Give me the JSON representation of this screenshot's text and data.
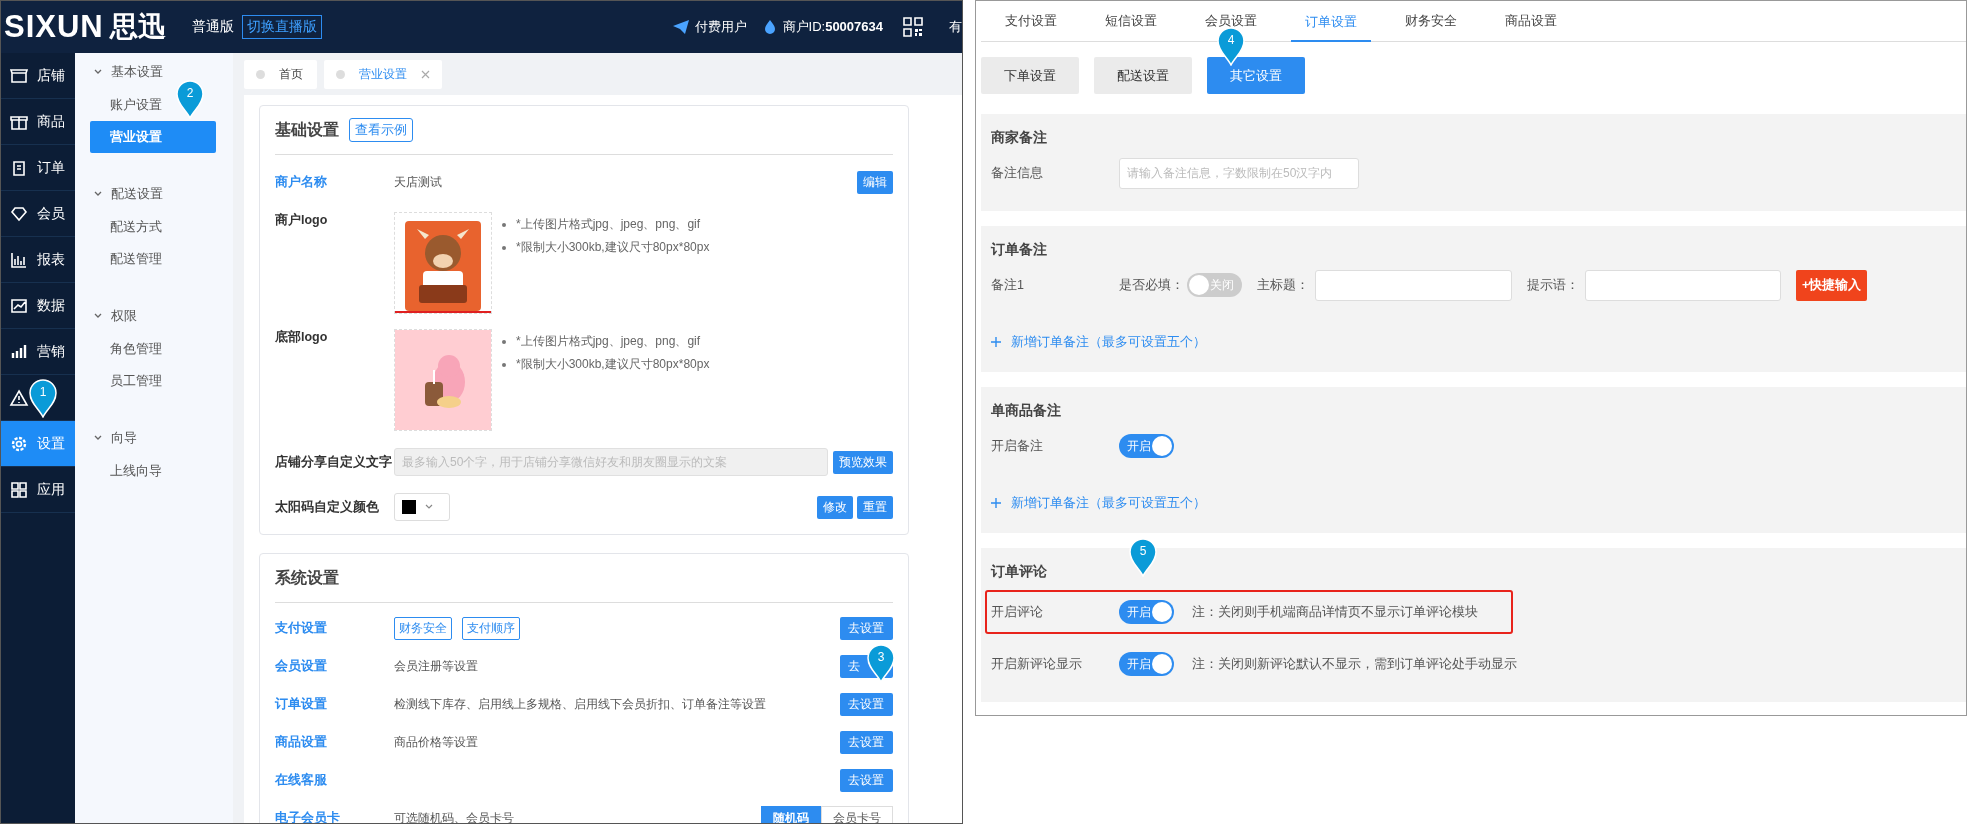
{
  "left": {
    "header": {
      "logo": "SIXUN",
      "logo_cn": "思迅",
      "edition": "普通版",
      "switch_button": "切换直播版",
      "user_type": "付费用户",
      "merchant_id": "商户ID:**50007634**",
      "cut_text": "有"
    },
    "nav": [
      {
        "label": "店铺",
        "selected": false
      },
      {
        "label": "商品",
        "selected": false
      },
      {
        "label": "订单",
        "selected": false
      },
      {
        "label": "会员",
        "selected": false
      },
      {
        "label": "报表",
        "selected": false
      },
      {
        "label": "数据",
        "selected": false
      },
      {
        "label": "营销",
        "selected": false
      },
      {
        "selected": false
      },
      {
        "label": "设置",
        "selected": true
      },
      {
        "label": "应用",
        "selected": false
      }
    ],
    "submenu": [
      {
        "label": "基本设置",
        "expanded": true,
        "children": [
          {
            "label": "账户设置",
            "selected": false
          },
          {
            "label": "营业设置",
            "selected": true
          }
        ]
      },
      {
        "label": "配送设置",
        "expanded": true,
        "children": [
          {
            "label": "配送方式",
            "selected": false
          },
          {
            "label": "配送管理",
            "selected": false
          }
        ]
      },
      {
        "label": "权限",
        "expanded": true,
        "children": [
          {
            "label": "角色管理",
            "selected": false
          },
          {
            "label": "员工管理",
            "selected": false
          }
        ]
      },
      {
        "label": "向导",
        "expanded": true,
        "children": [
          {
            "label": "上线向导",
            "selected": false
          }
        ]
      }
    ],
    "tabs": [
      {
        "label": "首页",
        "selected": false,
        "closable": false
      },
      {
        "label": "营业设置",
        "selected": true,
        "closable": true
      }
    ],
    "basic_settings": {
      "title": "基础设置",
      "example_button": "查看示例",
      "name_row": {
        "label": "商户名称",
        "value": "天店测试",
        "button": "编辑"
      },
      "logo_rows": [
        {
          "label": "商户logo",
          "notes": [
            "*上传图片格式jpg、jpeg、png、gif",
            "*限制大小300kb,建议尺寸80px*80px"
          ]
        },
        {
          "label": "底部logo",
          "notes": [
            "*上传图片格式jpg、jpeg、png、gif",
            "*限制大小300kb,建议尺寸80px*80px"
          ]
        }
      ],
      "share_row": {
        "label": "店铺分享自定义文字",
        "placeholder": "最多输入50个字，用于店铺分享微信好友和朋友圈显示的文案",
        "button": "预览效果"
      },
      "color_row": {
        "label": "太阳码自定义颜色",
        "buttons": [
          "修改",
          "重置"
        ]
      }
    },
    "system_settings": {
      "title": "系统设置",
      "rows": [
        {
          "kind": "tags",
          "label": "支付设置",
          "tags": [
            "财务安全",
            "支付顺序"
          ],
          "button": "去设置"
        },
        {
          "kind": "text",
          "label": "会员设置",
          "description": "会员注册等设置",
          "button": "去"
        },
        {
          "kind": "text",
          "label": "订单设置",
          "description": "检测线下库存、启用线上多规格、启用线下会员折扣、订单备注等设置",
          "button": "去设置"
        },
        {
          "kind": "text",
          "label": "商品设置",
          "description": "商品价格等设置",
          "button": "去设置"
        },
        {
          "kind": "text",
          "label": "在线客服",
          "button": "去设置"
        },
        {
          "kind": "segment",
          "label": "电子会员卡",
          "description": "可选随机码、会员卡号",
          "segments": [
            {
              "label": "随机码",
              "selected": true
            },
            {
              "label": "会员卡号",
              "selected": false
            }
          ]
        }
      ]
    }
  },
  "right": {
    "tabs": [
      {
        "label": "支付设置",
        "selected": false
      },
      {
        "label": "短信设置",
        "selected": false
      },
      {
        "label": "会员设置",
        "selected": false
      },
      {
        "label": "订单设置",
        "selected": true
      },
      {
        "label": "财务安全",
        "selected": false
      },
      {
        "label": "商品设置",
        "selected": false
      }
    ],
    "sub_tabs": [
      {
        "label": "下单设置",
        "selected": false
      },
      {
        "label": "配送设置",
        "selected": false
      },
      {
        "label": "其它设置",
        "selected": true
      }
    ],
    "sections": [
      {
        "title": "商家备注",
        "rows": [
          {
            "kind": "input",
            "label": "备注信息",
            "placeholder": "请输入备注信息，字数限制在50汉字内"
          }
        ]
      },
      {
        "title": "订单备注",
        "rows": [
          {
            "kind": "note_fields",
            "label": "备注1",
            "required_label": "是否必填：",
            "toggle": {
              "on": false,
              "text": "关闭"
            },
            "title_label": "主标题：",
            "hint_label": "提示语：",
            "quick_button": "+快捷输入"
          }
        ],
        "add_link": "新增订单备注（最多可设置五个）"
      },
      {
        "title": "单商品备注",
        "rows": [
          {
            "kind": "toggle",
            "label": "开启备注",
            "toggle": {
              "on": true,
              "text": "开启"
            }
          }
        ],
        "add_link": "新增订单备注（最多可设置五个）"
      },
      {
        "title": "订单评论",
        "rows": [
          {
            "kind": "toggle",
            "label": "开启评论",
            "toggle": {
              "on": true,
              "text": "开启"
            },
            "note": "注：关闭则手机端商品详情页不显示订单评论模块",
            "highlighted": true
          },
          {
            "kind": "toggle",
            "label": "开启新评论显示",
            "toggle": {
              "on": true,
              "text": "开启"
            },
            "note": "注：关闭则新评论默认不显示，需到订单评论处手动显示",
            "highlighted": false
          }
        ]
      }
    ]
  },
  "markers": [
    "1",
    "2",
    "3",
    "4",
    "5"
  ]
}
